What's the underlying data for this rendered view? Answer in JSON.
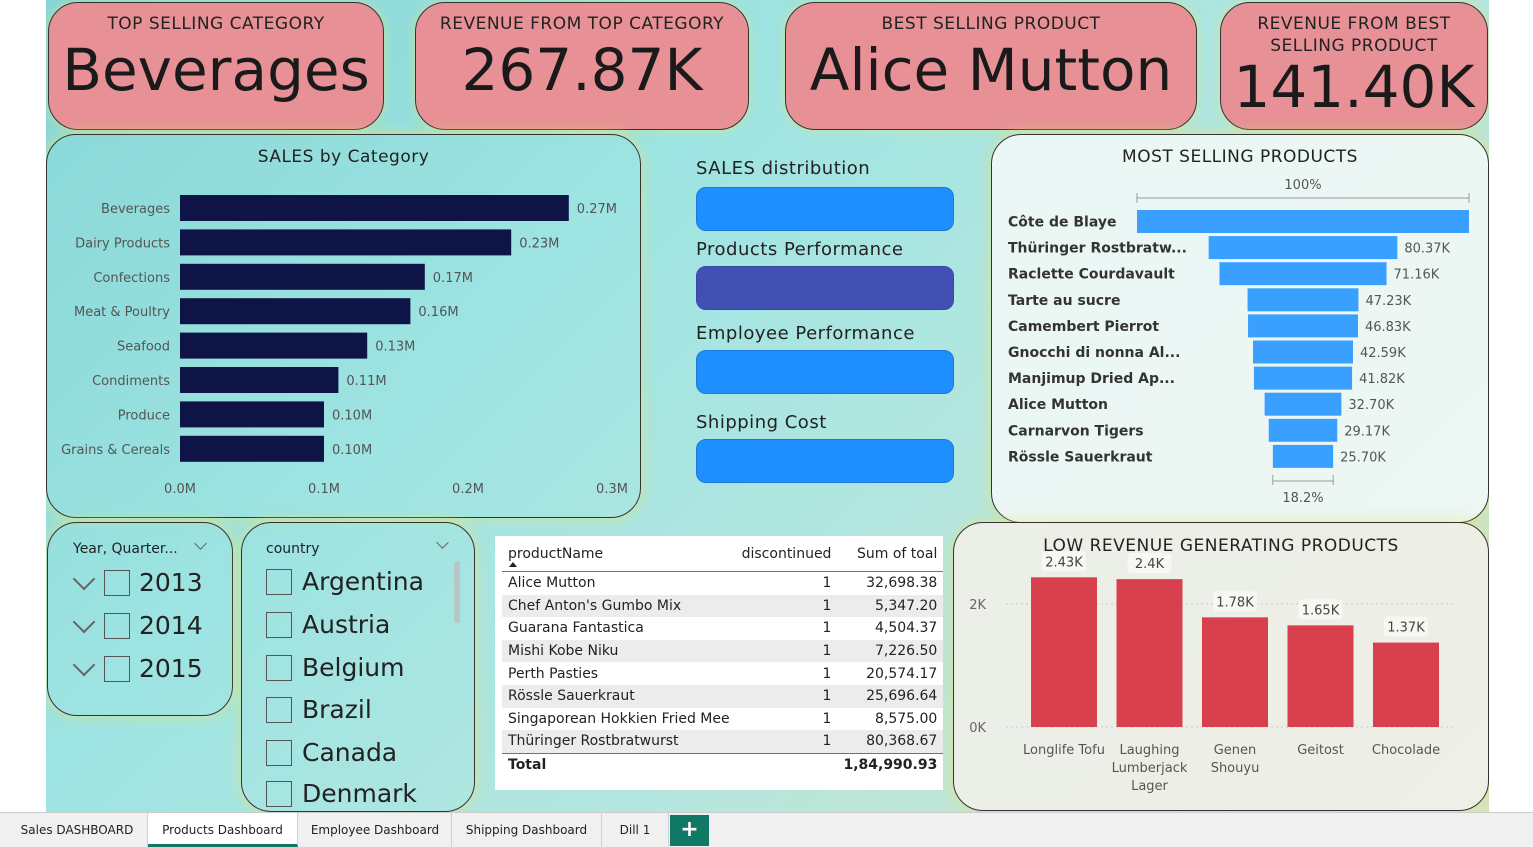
{
  "kpis": {
    "top_category_label": "TOP SELLING CATEGORY",
    "top_category_value": "Beverages",
    "top_category_revenue_label": "REVENUE FROM TOP CATEGORY",
    "top_category_revenue_value": "267.87K",
    "best_product_label": "BEST SELLING PRODUCT",
    "best_product_value": "Alice Mutton",
    "best_product_revenue_label_line1": "REVENUE FROM BEST",
    "best_product_revenue_label_line2": "SELLING PRODUCT",
    "best_product_revenue_value": "141.40K"
  },
  "colors": {
    "kpi_bg": "#e79196",
    "bar_navy": "#0f1446",
    "funnel_blue": "#3aa0ff",
    "low_rev_red": "#d8404e",
    "nav_blue": "#1f8fff",
    "nav_active": "#4350b3"
  },
  "nav": {
    "sales_distribution": "SALES distribution",
    "products_performance": "Products Performance",
    "employee_performance": "Employee Performance",
    "shipping_cost": "Shipping Cost"
  },
  "chart_data": [
    {
      "type": "bar",
      "orientation": "horizontal",
      "title": "SALES by Category",
      "categories": [
        "Beverages",
        "Dairy Products",
        "Confections",
        "Meat & Poultry",
        "Seafood",
        "Condiments",
        "Produce",
        "Grains & Cereals"
      ],
      "values": [
        0.27,
        0.23,
        0.17,
        0.16,
        0.13,
        0.11,
        0.1,
        0.1
      ],
      "data_labels": [
        "0.27M",
        "0.23M",
        "0.17M",
        "0.16M",
        "0.13M",
        "0.11M",
        "0.10M",
        "0.10M"
      ],
      "x_ticks": [
        "0.0M",
        "0.1M",
        "0.2M",
        "0.3M"
      ],
      "xlim": [
        0,
        0.3
      ],
      "unit": "M"
    },
    {
      "type": "funnel",
      "title": "MOST SELLING PRODUCTS",
      "top_label": "100%",
      "bottom_label": "18.2%",
      "categories": [
        "Côte de Blaye",
        "Thüringer Rostbratw...",
        "Raclette Courdavault",
        "Tarte au sucre",
        "Camembert Pierrot",
        "Gnocchi di nonna Al...",
        "Manjimup Dried Ap...",
        "Alice Mutton",
        "Carnarvon Tigers",
        "Rössle Sauerkraut"
      ],
      "values": [
        141.4,
        80.37,
        71.16,
        47.23,
        46.83,
        42.59,
        41.82,
        32.7,
        29.17,
        25.7
      ],
      "data_labels": [
        "",
        "80.37K",
        "71.16K",
        "47.23K",
        "46.83K",
        "42.59K",
        "41.82K",
        "32.70K",
        "29.17K",
        "25.70K"
      ],
      "unit": "K"
    },
    {
      "type": "bar",
      "title": "LOW REVENUE GENERATING PRODUCTS",
      "categories": [
        "Longlife Tofu",
        "Laughing Lumberjack Lager",
        "Genen Shouyu",
        "Geitost",
        "Chocolade"
      ],
      "category_lines": [
        [
          "Longlife Tofu"
        ],
        [
          "Laughing",
          "Lumberjack",
          "Lager"
        ],
        [
          "Genen",
          "Shouyu"
        ],
        [
          "Geitost"
        ],
        [
          "Chocolade"
        ]
      ],
      "values": [
        2.43,
        2.4,
        1.78,
        1.65,
        1.37
      ],
      "data_labels": [
        "2.43K",
        "2.4K",
        "1.78K",
        "1.65K",
        "1.37K"
      ],
      "y_ticks": [
        "0K",
        "2K"
      ],
      "ylim": [
        0,
        2.5
      ],
      "unit": "K"
    }
  ],
  "slicers": {
    "year": {
      "title": "Year, Quarter...",
      "items": [
        "2013",
        "2014",
        "2015"
      ]
    },
    "country": {
      "title": "country",
      "items": [
        "Argentina",
        "Austria",
        "Belgium",
        "Brazil",
        "Canada",
        "Denmark"
      ]
    }
  },
  "table": {
    "headers": [
      "productName",
      "discontinued",
      "Sum of toal"
    ],
    "rows": [
      [
        "Alice Mutton",
        "1",
        "32,698.38"
      ],
      [
        "Chef Anton's Gumbo Mix",
        "1",
        "5,347.20"
      ],
      [
        "Guarana Fantastica",
        "1",
        "4,504.37"
      ],
      [
        "Mishi Kobe Niku",
        "1",
        "7,226.50"
      ],
      [
        "Perth Pasties",
        "1",
        "20,574.17"
      ],
      [
        "Rössle Sauerkraut",
        "1",
        "25,696.64"
      ],
      [
        "Singaporean Hokkien Fried Mee",
        "1",
        "8,575.00"
      ],
      [
        "Thüringer Rostbratwurst",
        "1",
        "80,368.67"
      ]
    ],
    "total_label": "Total",
    "total_value": "1,84,990.93"
  },
  "tabs": {
    "items": [
      "Sales DASHBOARD",
      "Products Dashboard",
      "Employee Dashboard",
      "Shipping Dashboard",
      "Dill 1"
    ],
    "active": "Products Dashboard",
    "add_label": "+"
  }
}
